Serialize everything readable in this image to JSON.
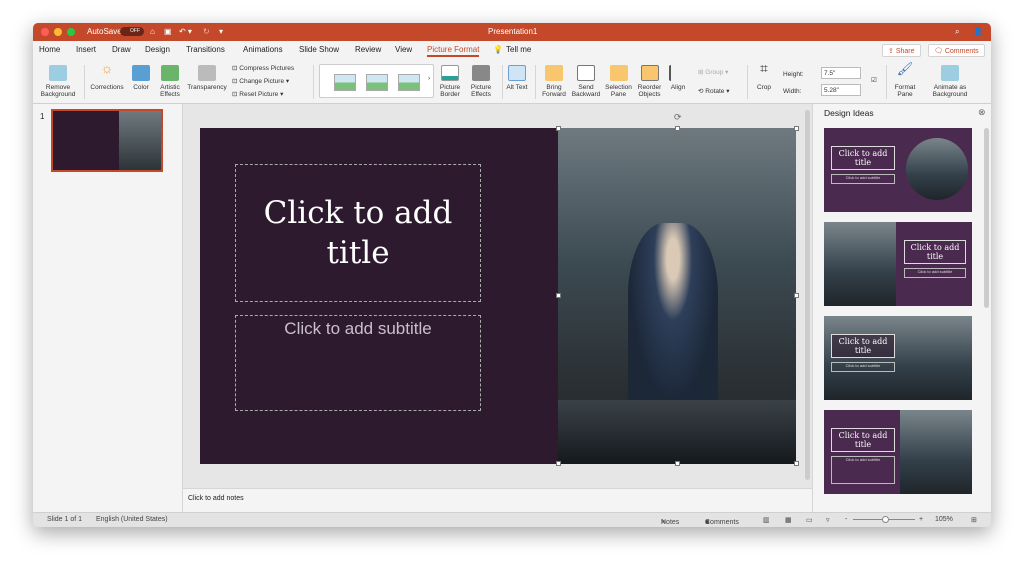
{
  "app": {
    "title": "Presentation1",
    "autosave_label": "AutoSave",
    "autosave_state": "OFF",
    "accent": "#c4492b"
  },
  "tabs": [
    "Home",
    "Insert",
    "Draw",
    "Design",
    "Transitions",
    "Animations",
    "Slide Show",
    "Review",
    "View",
    "Picture Format"
  ],
  "active_tab": "Picture Format",
  "tell_me": "Tell me",
  "share": "Share",
  "comments_btn": "Comments",
  "ribbon": {
    "remove_bg": "Remove Background",
    "corrections": "Corrections",
    "color": "Color",
    "artistic": "Artistic Effects",
    "transparency": "Transparency",
    "compress": "Compress Pictures",
    "change": "Change Picture",
    "reset": "Reset Picture",
    "border": "Picture Border",
    "effects": "Picture Effects",
    "alt": "Alt Text",
    "bring": "Bring Forward",
    "send": "Send Backward",
    "selection": "Selection Pane",
    "reorder": "Reorder Objects",
    "align": "Align",
    "group": "Group",
    "rotate": "Rotate",
    "crop": "Crop",
    "height_label": "Height:",
    "height_value": "7.5\"",
    "width_label": "Width:",
    "width_value": "5.28\"",
    "format_pane": "Format Pane",
    "animate_bg": "Animate as Background"
  },
  "thumbs": {
    "number": "1"
  },
  "slide": {
    "title": "Click to add title",
    "subtitle": "Click to add subtitle",
    "bg": "#2e1a2f"
  },
  "notes": "Click to add notes",
  "design": {
    "title": "Design Ideas",
    "ideas": [
      {
        "title": "Click to add title",
        "subtitle": "Click to add subtitle"
      },
      {
        "title": "Click to add title",
        "subtitle": "Click to add subtitle"
      },
      {
        "title": "Click to add title",
        "subtitle": "Click to add subtitle"
      },
      {
        "title": "Click to add title",
        "subtitle": "Click to add subtitle"
      }
    ]
  },
  "status": {
    "slide": "Slide 1 of 1",
    "lang": "English (United States)",
    "notes": "Notes",
    "comments": "Comments",
    "zoom": "105%",
    "zoom_minus": "-",
    "zoom_plus": "+"
  }
}
